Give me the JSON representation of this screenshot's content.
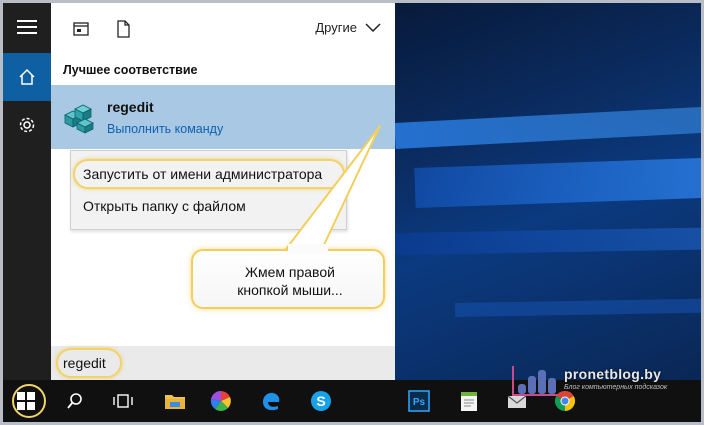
{
  "search_panel": {
    "others_label": "Другие",
    "section_title": "Лучшее соответствие",
    "best_match": {
      "name": "regedit",
      "subtitle": "Выполнить команду"
    },
    "context_menu": [
      "Запустить от имени администратора",
      "Открыть папку с файлом"
    ],
    "callout": "Жмем правой\nкнопкой мыши..."
  },
  "search": {
    "value": "regedit"
  },
  "rail": {
    "items": [
      "menu-icon",
      "home-icon",
      "gear-icon"
    ]
  },
  "taskbar": {
    "items": [
      "windows-start-icon",
      "search-icon",
      "task-view-icon",
      "file-explorer-icon",
      "photos-icon",
      "edge-icon",
      "skype-icon",
      "photoshop-icon",
      "notepad-icon",
      "mail-icon",
      "chrome-icon"
    ]
  },
  "watermark": {
    "site": "pronetblog.by",
    "tagline": "Блог компьютерных подсказок"
  },
  "colors": {
    "accent_blue": "#0f5fa3",
    "selected_row": "#a8c8e4",
    "highlight_yellow": "#f0d36a",
    "rail_bg": "#1f1f1f",
    "taskbar_bg": "#101010"
  }
}
